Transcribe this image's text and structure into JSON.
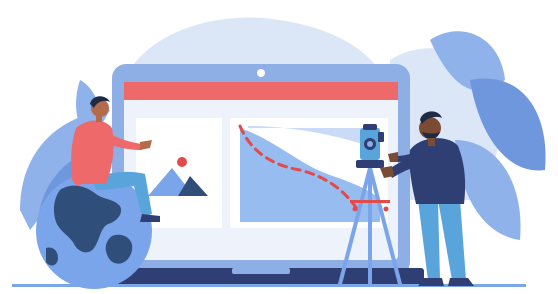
{
  "illustration": {
    "palette": {
      "blob_light": "#dbe7f6",
      "leaf_blue": "#8fb2ea",
      "laptop_frame": "#8eaee6",
      "screen_bg": "#eef3fb",
      "browser_bar": "#ee6a6a",
      "map_blue": "#97bcef",
      "path_red": "#e34b4b",
      "ground": "#7aa7e8",
      "globe_ocean": "#7aa5ea",
      "globe_land": "#2f4f7a",
      "shirt_red": "#ee6a6a",
      "jacket_navy": "#2f3f73",
      "pants_blue": "#5aa4dc",
      "skin_brown": "#b46b4c",
      "skin_dark": "#7b4b34"
    }
  }
}
